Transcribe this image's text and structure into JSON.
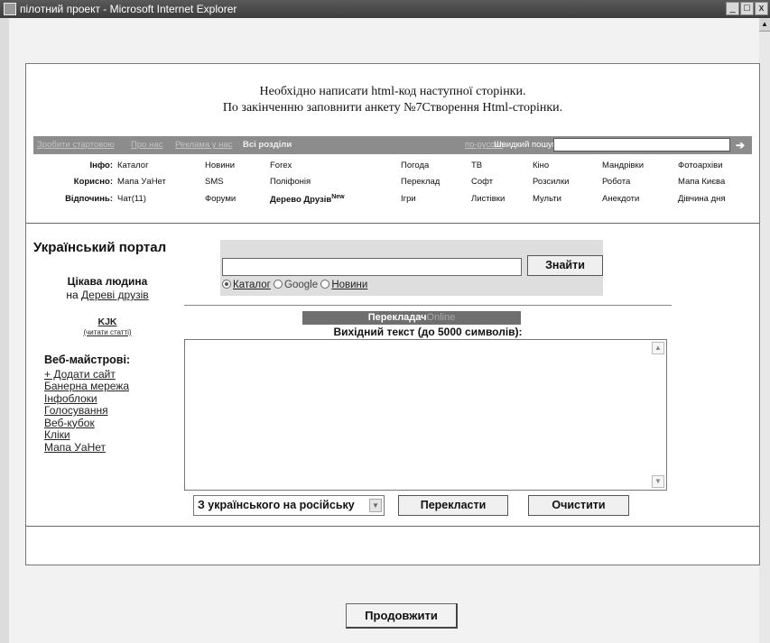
{
  "window": {
    "title": "пілотний проект - Microsoft Internet Explorer",
    "controls": [
      "_",
      "□",
      "x"
    ]
  },
  "task": {
    "line1": "Необхідно написати html-код наступної сторінки.",
    "line2": "По закінченню заповнити анкету №7Створення Html-сторінки."
  },
  "topbar": {
    "links": [
      "Зробити стартовою",
      "Про нас",
      "Реклама у нас",
      "Всі розділи"
    ],
    "lang_link": "по-русски",
    "quick_search_label": "Швидкий пошук:",
    "quick_search_value": "",
    "go_symbol": "➔"
  },
  "categories": {
    "rows": [
      {
        "label": "Інфо:",
        "items": [
          "Каталог",
          "Новини",
          "Forex",
          "Погода",
          "ТВ",
          "Кіно",
          "Мандрівки",
          "Фотоархіви"
        ]
      },
      {
        "label": "Корисно:",
        "items": [
          "Мапа УаНет",
          "SMS",
          "Поліфонія",
          "Переклад",
          "Софт",
          "Розсилки",
          "Робота",
          "Мапа Києва"
        ]
      },
      {
        "label": "Відпочинь:",
        "items": [
          "Чат(11)",
          "Форуми",
          "Дерево Друзів",
          "Ігри",
          "Листівки",
          "Мульти",
          "Анекдоти",
          "Дівчина дня"
        ]
      }
    ],
    "new_badge": "New"
  },
  "left": {
    "portal_title": "Український портал",
    "interesting_title": "Цікава людина",
    "interesting_prefix": "на",
    "interesting_link": "Дереві друзів",
    "kjk_title": "KJK",
    "kjk_link": "(читати статті)",
    "webmasters_title": "Веб-майстрові:",
    "webmasters_items": [
      "+ Додати сайт",
      "Банерна мережа",
      "Інфоблоки",
      "Голосування",
      "Веб-кубок",
      "Кліки",
      "Мапа УаНет"
    ]
  },
  "search": {
    "value": "",
    "button": "Знайти",
    "options": [
      "Каталог",
      "Google",
      "Новини"
    ],
    "selected": "Каталог"
  },
  "translator": {
    "header_main": "Перекладач",
    "header_suffix": "Online",
    "source_label": "Вихідний текст (до 5000 символів):",
    "source_text": "",
    "direction": "З українського на російську",
    "translate_button": "Перекласти",
    "clear_button": "Очистити"
  },
  "continue_button": "Продовжити"
}
